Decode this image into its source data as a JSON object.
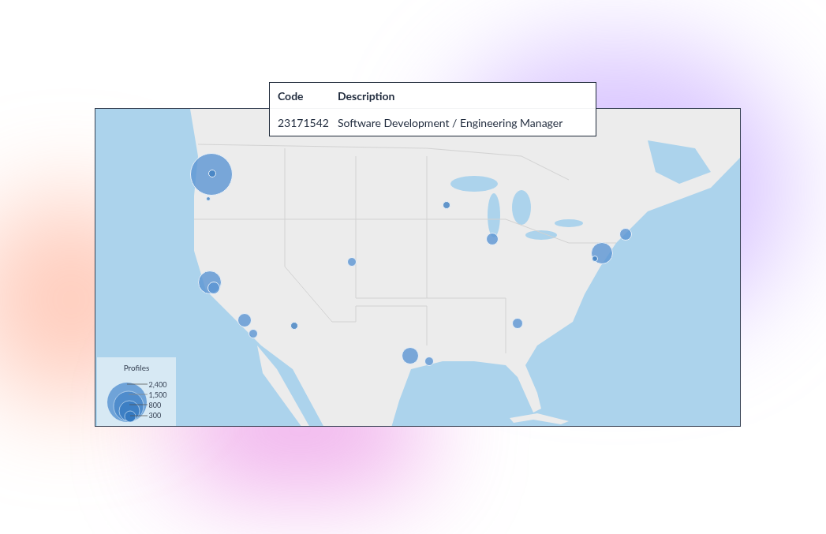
{
  "table": {
    "columns": [
      "Code",
      "Description"
    ],
    "rows": [
      [
        "23171542",
        "Software Development / Engineering Manager"
      ]
    ]
  },
  "map": {
    "legend": {
      "title": "Profiles",
      "entries": [
        "2,400",
        "1,500",
        "800",
        "300"
      ]
    }
  }
}
